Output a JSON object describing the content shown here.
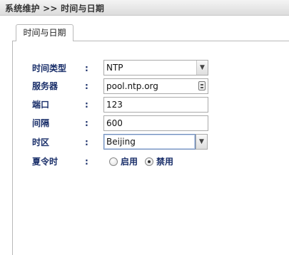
{
  "breadcrumb": "系统维护 >> 时间与日期",
  "tab": {
    "label": "时间与日期"
  },
  "form": {
    "time_type": {
      "label": "时间类型",
      "colon": ":",
      "value": "NTP"
    },
    "server": {
      "label": "服务器",
      "colon": ":",
      "value": "pool.ntp.org"
    },
    "port": {
      "label": "端口",
      "colon": ":",
      "value": "123"
    },
    "interval": {
      "label": "间隔",
      "colon": ":",
      "value": "600"
    },
    "timezone": {
      "label": "时区",
      "colon": ":",
      "value": "Beijing"
    },
    "dst": {
      "label": "夏令时",
      "colon": ":",
      "options": [
        {
          "label": "启用",
          "checked": false
        },
        {
          "label": "禁用",
          "checked": true
        }
      ]
    }
  },
  "icons": {
    "dropdown": "▼"
  }
}
